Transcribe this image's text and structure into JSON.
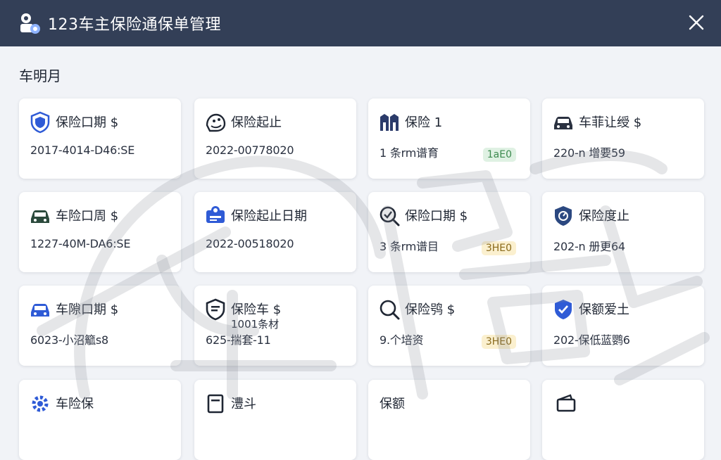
{
  "app": {
    "title": "123车主保险通保单管理"
  },
  "section": {
    "title": "车明月"
  },
  "cards": [
    {
      "title": "保险口期 $",
      "value": "2017-4014-D46:SE"
    },
    {
      "title": "保险起止",
      "value": "2022-00778020"
    },
    {
      "title": "保险 1",
      "value": "1 条rm谱育",
      "badge": "1aE0"
    },
    {
      "title": "车菲让绶 $",
      "value": "220-n 增要59"
    },
    {
      "title": "车险口周 $",
      "value": "1227-40M-DA6:SE"
    },
    {
      "title": "保险起止日期",
      "value": "2022-00518020"
    },
    {
      "title": "保险口期 $",
      "value": "3 条rm谱目",
      "badge": "3HE0"
    },
    {
      "title": "保险度止",
      "value": "202-n 册更64"
    },
    {
      "title": "车隙口期 $",
      "value": "6023-小沼䉉s8"
    },
    {
      "title": "保险车 $",
      "sub": "1001条材",
      "value": "625-揣套-11"
    },
    {
      "title": "保险鸮 $",
      "value": "9.个培资",
      "badge": "3HE0"
    },
    {
      "title": "保额爱土",
      "value": "202-保低蓝鹦6"
    },
    {
      "title": "车险保",
      "value": ""
    },
    {
      "title": "澧斗",
      "value": ""
    },
    {
      "title": "保额",
      "value": ""
    },
    {
      "title": "",
      "value": ""
    }
  ],
  "colors": {
    "titlebar": "#333f57",
    "accent_blue": "#2f5bd6",
    "dark_green": "#2b4a3c",
    "badge_green": "#dff1e3",
    "badge_yellow": "#fbf0cf"
  },
  "icons": [
    "shield-car-icon",
    "speedometer-icon",
    "people-icon",
    "car-icon",
    "car-green-icon",
    "insurance-id-icon",
    "search-check-icon",
    "shield-gauge-icon",
    "car-blue-icon",
    "shield-doc-icon",
    "search-icon",
    "shield-check-icon",
    "gear-icon",
    "doc-icon",
    "blank-icon",
    "wallet-icon"
  ]
}
